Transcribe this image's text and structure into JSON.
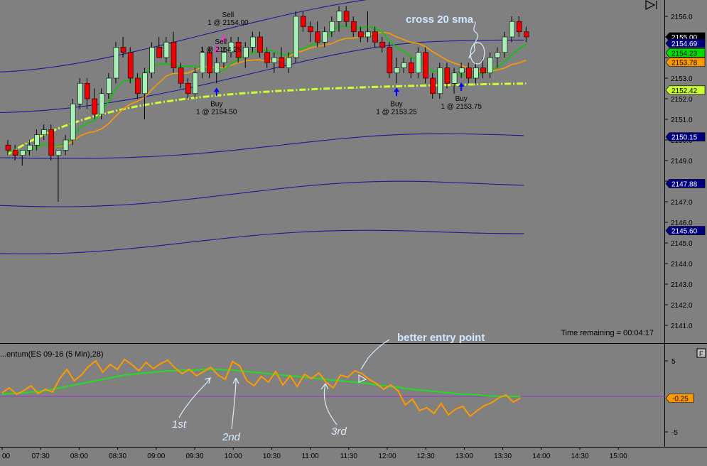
{
  "chart_data": [
    {
      "type": "candlestick",
      "symbol_panel": "price",
      "y_ticks": [
        2141,
        2142,
        2143,
        2144,
        2145,
        2146,
        2147,
        2148,
        2149,
        2150,
        2151,
        2152,
        2153,
        2154,
        2155,
        2156
      ],
      "ylim": [
        2140.5,
        2156.7
      ],
      "price_tags": [
        {
          "label": "2155.00",
          "value": 2155.0,
          "color": "#000000",
          "text_color": "#ffffff"
        },
        {
          "label": "2154.69",
          "value": 2154.69,
          "color": "#000080",
          "text_color": "#ffffff"
        },
        {
          "label": "2154.23",
          "value": 2154.23,
          "color": "#00dd00",
          "text_color": "#000000"
        },
        {
          "label": "2153.78",
          "value": 2153.78,
          "color": "#ff9900",
          "text_color": "#000000"
        },
        {
          "label": "2152.42",
          "value": 2152.42,
          "color": "#ccff33",
          "text_color": "#000000"
        },
        {
          "label": "2150.15",
          "value": 2150.15,
          "color": "#000080",
          "text_color": "#ffffff"
        },
        {
          "label": "2147.88",
          "value": 2147.88,
          "color": "#000080",
          "text_color": "#ffffff"
        },
        {
          "label": "2145.60",
          "value": 2145.6,
          "color": "#000080",
          "text_color": "#ffffff"
        }
      ],
      "time_remaining": "Time remaining = 00:04:17",
      "annotations": {
        "cross_sma": "cross 20 sma",
        "trades": [
          {
            "side": "Sell",
            "text": "Sell",
            "qty": "1 @ 2154.00",
            "bar": 30
          },
          {
            "side": "Sell",
            "text": "Sell",
            "qty": "1 @ 2154.25",
            "bar": 29
          },
          {
            "side": "Buy",
            "text": "Buy",
            "qty": "1 @ 2154.50",
            "bar": 29
          },
          {
            "side": "Buy",
            "text": "Buy",
            "qty": "1 @ 2153.25",
            "bar": 54
          },
          {
            "side": "Buy",
            "text": "Buy",
            "qty": "1 @ 2153.75",
            "bar": 63
          }
        ]
      },
      "series": [
        {
          "name": "bollinger_upper_2",
          "values_start": 2153.3,
          "values_end": 2157.2
        },
        {
          "name": "bollinger_upper_1",
          "values_start": 2151.2,
          "values_end": 2154.7
        },
        {
          "name": "bollinger_mid",
          "values_start": 2149.0,
          "values_end": 2150.15
        },
        {
          "name": "bollinger_lower_1",
          "values_start": 2146.8,
          "values_end": 2147.88
        },
        {
          "name": "bollinger_lower_2",
          "values_start": 2144.6,
          "values_end": 2145.6
        }
      ],
      "candles": [
        [
          2149.75,
          2150.0,
          2149.25,
          2149.5
        ],
        [
          2149.5,
          2149.75,
          2149.0,
          2149.25
        ],
        [
          2149.25,
          2149.5,
          2148.75,
          2149.5
        ],
        [
          2149.5,
          2150.0,
          2149.25,
          2149.75
        ],
        [
          2149.75,
          2150.5,
          2149.5,
          2150.25
        ],
        [
          2150.25,
          2150.75,
          2150.0,
          2150.5
        ],
        [
          2150.5,
          2150.75,
          2149.0,
          2149.25
        ],
        [
          2149.25,
          2149.5,
          2147.0,
          2149.5
        ],
        [
          2149.5,
          2150.25,
          2149.25,
          2150.0
        ],
        [
          2150.0,
          2152.0,
          2149.75,
          2151.75
        ],
        [
          2151.75,
          2153.0,
          2151.5,
          2152.75
        ],
        [
          2152.75,
          2153.0,
          2151.5,
          2152.0
        ],
        [
          2152.0,
          2152.5,
          2151.0,
          2151.25
        ],
        [
          2151.25,
          2152.5,
          2151.0,
          2152.25
        ],
        [
          2152.25,
          2153.25,
          2152.0,
          2153.0
        ],
        [
          2153.0,
          2154.75,
          2152.75,
          2154.5
        ],
        [
          2154.5,
          2155.0,
          2154.0,
          2154.25
        ],
        [
          2154.25,
          2154.5,
          2152.75,
          2153.0
        ],
        [
          2153.0,
          2153.25,
          2152.0,
          2152.25
        ],
        [
          2152.25,
          2153.5,
          2151.0,
          2153.25
        ],
        [
          2153.25,
          2154.75,
          2153.0,
          2154.5
        ],
        [
          2154.5,
          2155.0,
          2154.0,
          2154.0
        ],
        [
          2154.0,
          2155.0,
          2153.75,
          2154.75
        ],
        [
          2154.75,
          2155.25,
          2153.25,
          2153.5
        ],
        [
          2153.5,
          2153.75,
          2152.5,
          2152.75
        ],
        [
          2152.75,
          2153.0,
          2152.0,
          2152.25
        ],
        [
          2152.25,
          2153.5,
          2152.0,
          2153.25
        ],
        [
          2153.25,
          2154.5,
          2153.0,
          2154.25
        ],
        [
          2154.25,
          2154.5,
          2153.0,
          2153.25
        ],
        [
          2153.25,
          2154.0,
          2152.75,
          2153.75
        ],
        [
          2153.75,
          2154.5,
          2153.5,
          2154.25
        ],
        [
          2154.25,
          2155.0,
          2154.0,
          2154.75
        ],
        [
          2154.75,
          2155.0,
          2153.75,
          2154.0
        ],
        [
          2154.0,
          2154.75,
          2153.5,
          2154.5
        ],
        [
          2154.5,
          2155.25,
          2154.25,
          2155.0
        ],
        [
          2155.0,
          2155.25,
          2154.0,
          2154.25
        ],
        [
          2154.25,
          2154.5,
          2153.5,
          2153.75
        ],
        [
          2153.75,
          2154.25,
          2153.25,
          2154.0
        ],
        [
          2154.0,
          2154.5,
          2153.5,
          2153.5
        ],
        [
          2153.5,
          2154.25,
          2153.25,
          2154.0
        ],
        [
          2154.0,
          2156.25,
          2153.75,
          2156.0
        ],
        [
          2156.0,
          2156.25,
          2155.25,
          2155.5
        ],
        [
          2155.5,
          2155.75,
          2154.75,
          2155.25
        ],
        [
          2155.25,
          2155.75,
          2154.5,
          2154.75
        ],
        [
          2154.75,
          2155.5,
          2154.5,
          2155.25
        ],
        [
          2155.25,
          2156.0,
          2155.0,
          2155.75
        ],
        [
          2155.75,
          2156.5,
          2155.25,
          2156.25
        ],
        [
          2156.25,
          2156.5,
          2155.5,
          2155.75
        ],
        [
          2155.75,
          2156.0,
          2155.0,
          2155.25
        ],
        [
          2155.25,
          2155.5,
          2154.75,
          2155.0
        ],
        [
          2155.0,
          2156.25,
          2154.75,
          2155.25
        ],
        [
          2155.25,
          2155.5,
          2154.5,
          2154.75
        ],
        [
          2154.75,
          2155.0,
          2154.25,
          2154.5
        ],
        [
          2154.5,
          2154.75,
          2153.0,
          2153.25
        ],
        [
          2153.25,
          2154.0,
          2152.75,
          2153.5
        ],
        [
          2153.5,
          2154.0,
          2153.25,
          2153.75
        ],
        [
          2153.75,
          2154.0,
          2153.0,
          2153.25
        ],
        [
          2153.25,
          2154.5,
          2153.0,
          2154.25
        ],
        [
          2154.25,
          2154.5,
          2152.75,
          2153.0
        ],
        [
          2153.0,
          2153.25,
          2152.0,
          2152.25
        ],
        [
          2152.25,
          2153.75,
          2152.0,
          2153.5
        ],
        [
          2153.5,
          2153.75,
          2152.5,
          2152.75
        ],
        [
          2152.75,
          2153.5,
          2152.25,
          2153.25
        ],
        [
          2153.25,
          2153.75,
          2153.0,
          2153.5
        ],
        [
          2153.5,
          2153.75,
          2152.75,
          2153.0
        ],
        [
          2153.0,
          2153.75,
          2152.75,
          2153.5
        ],
        [
          2153.5,
          2154.0,
          2153.0,
          2153.25
        ],
        [
          2153.25,
          2154.25,
          2153.0,
          2154.0
        ],
        [
          2154.0,
          2154.5,
          2153.5,
          2154.25
        ],
        [
          2154.25,
          2155.25,
          2154.0,
          2155.0
        ],
        [
          2155.0,
          2156.0,
          2154.75,
          2155.75
        ],
        [
          2155.75,
          2156.0,
          2155.0,
          2155.25
        ],
        [
          2155.25,
          2155.5,
          2154.75,
          2155.0
        ]
      ]
    },
    {
      "type": "line",
      "title": "...entum(ES 09-16 (5 Min),28)",
      "y_ticks": [
        5,
        -5
      ],
      "ylim": [
        -6,
        7
      ],
      "value_tag": "-0.25",
      "annotations": [
        "better entry point",
        "1st",
        "2nd",
        "3rd"
      ],
      "x_ticks": [
        "00",
        "07:30",
        "08:00",
        "08:30",
        "09:00",
        "09:30",
        "10:00",
        "10:30",
        "11:00",
        "11:30",
        "12:00",
        "12:30",
        "13:00",
        "13:30",
        "14:00",
        "14:30",
        "15:00"
      ],
      "series": [
        {
          "name": "momentum",
          "values": [
            0.5,
            1.2,
            0.3,
            0.8,
            1.5,
            0.4,
            1.0,
            0.6,
            2.5,
            3.8,
            2.2,
            3.0,
            4.2,
            5.0,
            3.4,
            4.5,
            3.8,
            5.2,
            4.5,
            3.6,
            4.8,
            3.9,
            4.6,
            5.1,
            4.0,
            3.2,
            3.8,
            2.9,
            3.5,
            4.1,
            3.0,
            2.4,
            4.9,
            4.3,
            2.2,
            1.5,
            2.8,
            2.0,
            3.5,
            1.6,
            2.9,
            1.4,
            3.1,
            2.5,
            3.3,
            2.0,
            1.2,
            3.0,
            2.7,
            3.6,
            3.2,
            2.4,
            1.8,
            1.0,
            1.6,
            0.8,
            -1.2,
            -0.4,
            -2.0,
            -1.6,
            -2.4,
            -1.0,
            -2.6,
            -1.8,
            -1.4,
            -2.8,
            -2.0,
            -1.3,
            -0.9,
            -0.2,
            0.2,
            -0.8,
            -0.25
          ]
        },
        {
          "name": "momentum_avg",
          "values": [
            0.3,
            0.4,
            0.4,
            0.5,
            0.6,
            0.7,
            0.8,
            1.0,
            1.2,
            1.4,
            1.6,
            1.8,
            2.0,
            2.2,
            2.4,
            2.6,
            2.8,
            3.0,
            3.1,
            3.2,
            3.3,
            3.4,
            3.5,
            3.6,
            3.6,
            3.7,
            3.7,
            3.7,
            3.8,
            3.8,
            3.8,
            3.7,
            3.7,
            3.6,
            3.5,
            3.4,
            3.3,
            3.2,
            3.1,
            3.0,
            2.9,
            2.8,
            2.7,
            2.6,
            2.5,
            2.4,
            2.3,
            2.2,
            2.1,
            2.0,
            1.9,
            1.8,
            1.6,
            1.5,
            1.4,
            1.3,
            1.1,
            1.0,
            0.9,
            0.8,
            0.7,
            0.6,
            0.5,
            0.4,
            0.3,
            0.3,
            0.2,
            0.1,
            0.05,
            0.0,
            0.0,
            0.0,
            0.0
          ]
        }
      ]
    }
  ]
}
